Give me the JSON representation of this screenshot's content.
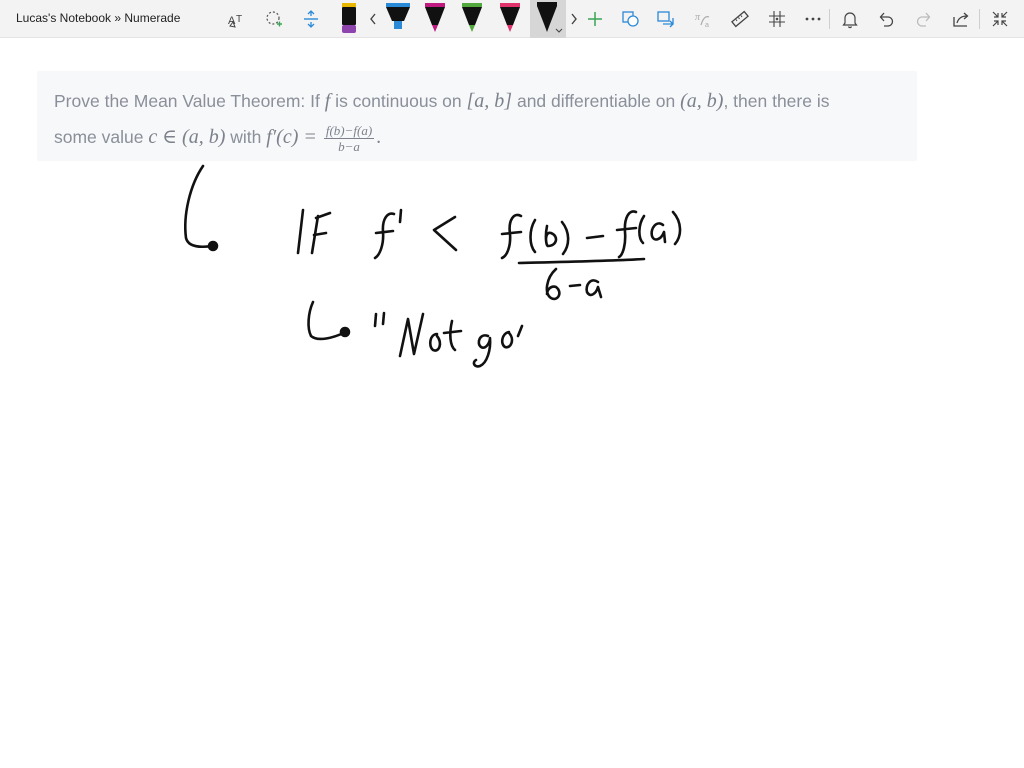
{
  "window": {
    "title": "Lucas's Notebook » Numerade"
  },
  "toolbar": {
    "icons": [
      "text-format-icon",
      "lasso-icon",
      "insert-space-icon",
      "pen-black-icon",
      "chevron-left-icon",
      "highlighter-blue-icon",
      "pen-magenta-icon",
      "pen-green-icon",
      "pen-pink-icon",
      "pen-black-selected-icon",
      "chevron-right-icon",
      "add-pen-icon",
      "shapes-icon",
      "ink-to-shape-icon",
      "ink-to-math-icon",
      "ruler-icon",
      "grid-icon",
      "more-icon",
      "bell-icon",
      "undo-icon",
      "redo-icon",
      "share-icon",
      "collapse-icon"
    ],
    "colors": {
      "blue": "#2b8ad8",
      "magenta": "#c0197f",
      "green": "#52a83c",
      "pink": "#e0336b",
      "black": "#111111",
      "purple": "#8e44ad",
      "accent_green": "#3aa556"
    }
  },
  "question": {
    "line1_a": "Prove the Mean Value Theorem: If ",
    "f": "f",
    "line1_b": " is continuous on ",
    "interval_closed": "[a, b]",
    "line1_c": " and differentiable on ",
    "interval_open": "(a, b)",
    "line1_d": ", then there is",
    "line2_a": "some value ",
    "c_in": "c ∈ (a, b)",
    "line2_b": " with ",
    "fprime": "f′(c) = ",
    "frac_num": "f(b)−f(a)",
    "frac_den": "b−a",
    "period": "."
  },
  "handwriting": {
    "line1_left": "IF",
    "line1_fprime": "f'",
    "line1_lt": "<",
    "line1_num": "f(b) - f(a)",
    "line1_den": "b - a",
    "line2": "\"Not go'"
  }
}
